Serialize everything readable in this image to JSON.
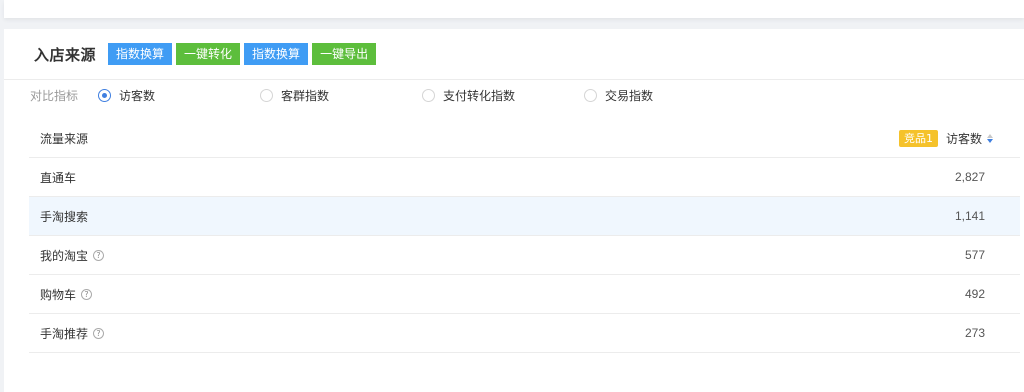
{
  "header": {
    "title": "入店来源",
    "buttons": [
      {
        "label": "指数换算",
        "color": "#3f9cf4"
      },
      {
        "label": "一键转化",
        "color": "#5dbe3c"
      },
      {
        "label": "指数换算",
        "color": "#3f9cf4"
      },
      {
        "label": "一键导出",
        "color": "#5dbe3c"
      }
    ]
  },
  "metrics": {
    "label": "对比指标",
    "options": [
      {
        "label": "访客数",
        "checked": true
      },
      {
        "label": "客群指数",
        "checked": false
      },
      {
        "label": "支付转化指数",
        "checked": false
      },
      {
        "label": "交易指数",
        "checked": false
      }
    ]
  },
  "table": {
    "col_source": "流量来源",
    "comp_badge": "竞品1",
    "col_value": "访客数",
    "rows": [
      {
        "source": "直通车",
        "value": "2,827",
        "help": false
      },
      {
        "source": "手淘搜索",
        "value": "1,141",
        "help": false
      },
      {
        "source": "我的淘宝",
        "value": "577",
        "help": true
      },
      {
        "source": "购物车",
        "value": "492",
        "help": true
      },
      {
        "source": "手淘推荐",
        "value": "273",
        "help": true
      }
    ]
  },
  "icons": {
    "help": "?"
  }
}
